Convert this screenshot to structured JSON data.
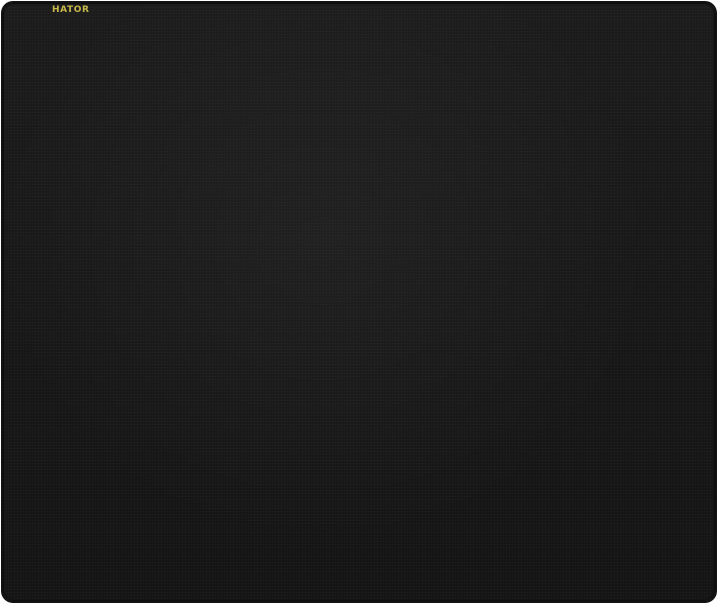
{
  "product": {
    "brand_logo": "HATOR",
    "colors": {
      "surface": "#181818",
      "edge": "#111111",
      "logo": "#c8b84a"
    }
  }
}
